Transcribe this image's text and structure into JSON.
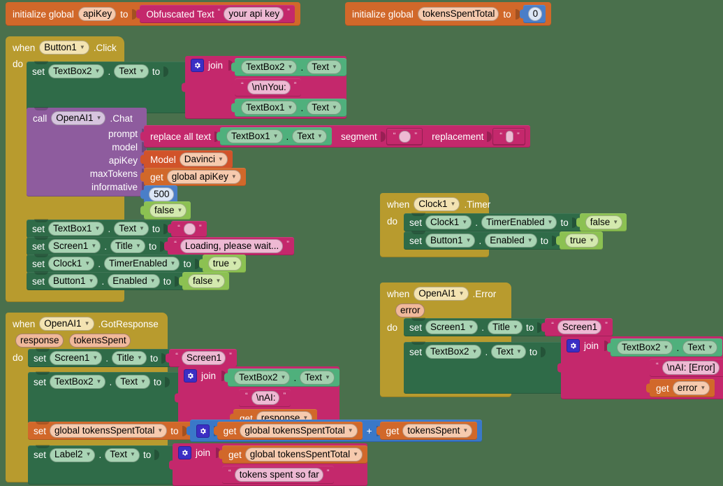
{
  "workspace": {
    "background_color": "#4a704c",
    "app": "MIT App Inventor Blocks Editor"
  },
  "globals": [
    {
      "id": "init-apikey",
      "keyword": "initialize global",
      "name": "apiKey",
      "to": "to",
      "value_block": "Obfuscated Text",
      "value_text": "your api key"
    },
    {
      "id": "init-tokens",
      "keyword": "initialize global",
      "name": "tokensSpentTotal",
      "to": "to",
      "value_number": "0"
    }
  ],
  "common": {
    "when": "when",
    "do": "do",
    "set": "set",
    "call": "call",
    "get": "get",
    "to": "to",
    "join": "join",
    "dot": ".",
    "plus": "+",
    "quote_open": "“",
    "quote_close": "”",
    "replace_all_text": "replace all text",
    "segment": "segment",
    "replacement": "replacement",
    "model_label": "Model"
  },
  "button1_click": {
    "event_component": "Button1",
    "event_name": ".Click",
    "set_textbox2": {
      "component": "TextBox2",
      "property": "Text"
    },
    "join_items": [
      {
        "component": "TextBox2",
        "property": "Text"
      },
      {
        "text": "\\n\\nYou:"
      },
      {
        "component": "TextBox1",
        "property": "Text"
      }
    ],
    "call": {
      "component": "OpenAI1",
      "method": ".Chat",
      "args": [
        {
          "name": "prompt"
        },
        {
          "name": "model"
        },
        {
          "name": "apiKey"
        },
        {
          "name": "maxTokens"
        },
        {
          "name": "informative"
        }
      ],
      "prompt_source": {
        "component": "TextBox1",
        "property": "Text"
      },
      "prompt_segment": "",
      "prompt_replacement": "",
      "model_value": "Davinci",
      "apikey_var": "global apiKey",
      "max_tokens": "500",
      "informative": "false"
    },
    "after_call": [
      {
        "component": "TextBox1",
        "property": "Text",
        "value_type": "text",
        "value": ""
      },
      {
        "component": "Screen1",
        "property": "Title",
        "value_type": "text",
        "value": "Loading, please wait..."
      },
      {
        "component": "Clock1",
        "property": "TimerEnabled",
        "value_type": "logic",
        "value": "true"
      },
      {
        "component": "Button1",
        "property": "Enabled",
        "value_type": "logic",
        "value": "false"
      }
    ]
  },
  "clock1_timer": {
    "event_component": "Clock1",
    "event_name": ".Timer",
    "statements": [
      {
        "component": "Clock1",
        "property": "TimerEnabled",
        "value": "false"
      },
      {
        "component": "Button1",
        "property": "Enabled",
        "value": "true"
      }
    ]
  },
  "openai_error": {
    "event_component": "OpenAI1",
    "event_name": ".Error",
    "params": [
      "error"
    ],
    "set_title": {
      "component": "Screen1",
      "property": "Title",
      "value": "Screen1"
    },
    "set_textbox2": {
      "component": "TextBox2",
      "property": "Text"
    },
    "join_items": [
      {
        "component": "TextBox2",
        "property": "Text"
      },
      {
        "text": "\\nAI: [Error]"
      },
      {
        "get": "error"
      }
    ]
  },
  "openai_gotresponse": {
    "event_component": "OpenAI1",
    "event_name": ".GotResponse",
    "params": [
      "response",
      "tokensSpent"
    ],
    "set_title": {
      "component": "Screen1",
      "property": "Title",
      "value": "Screen1"
    },
    "set_textbox2": {
      "component": "TextBox2",
      "property": "Text"
    },
    "join_items": [
      {
        "component": "TextBox2",
        "property": "Text"
      },
      {
        "text": "\\nAI:"
      },
      {
        "get": "response"
      }
    ],
    "set_global": {
      "target": "global tokensSpentTotal",
      "left": "global tokensSpentTotal",
      "right": "tokensSpent"
    },
    "set_label2": {
      "component": "Label2",
      "property": "Text",
      "join_items": [
        {
          "get": "global tokensSpentTotal"
        },
        {
          "text": "tokens spent so far"
        }
      ]
    }
  },
  "colors": {
    "event_gold": "#b89b2e",
    "control_statement_green": "#2f6b48",
    "component_getter_green": "#4fb07c",
    "text_magenta": "#c4286c",
    "variable_orange": "#d1682a",
    "math_blue": "#4a7ec8",
    "logic_lgreen": "#8cc152",
    "procedure_purple": "#8e5c9e"
  }
}
